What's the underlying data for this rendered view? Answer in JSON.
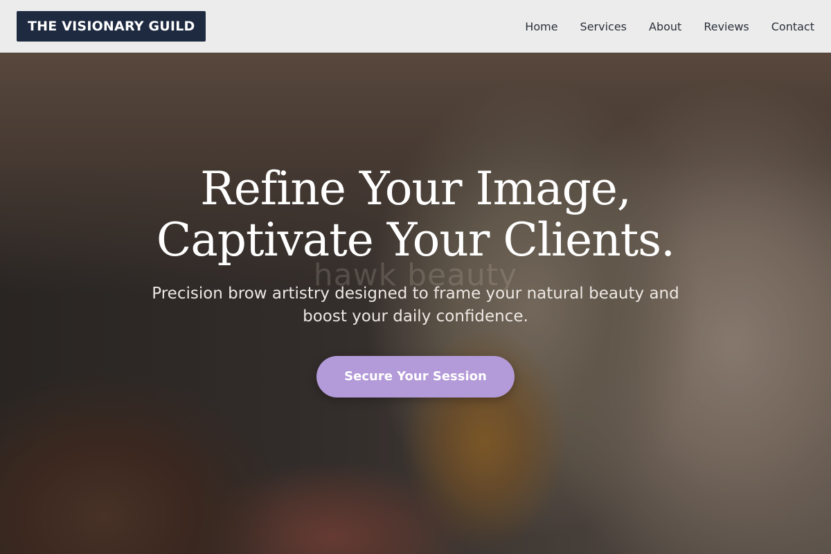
{
  "header": {
    "logo_text": "THE VISIONARY GUILD",
    "nav": [
      {
        "label": "Home"
      },
      {
        "label": "Services"
      },
      {
        "label": "About"
      },
      {
        "label": "Reviews"
      },
      {
        "label": "Contact"
      }
    ]
  },
  "hero": {
    "watermark": "hawk beauty",
    "title_line1": "Refine Your Image,",
    "title_line2": "Captivate Your Clients.",
    "subtitle": "Precision brow artistry designed to frame your natural beauty and boost your daily confidence.",
    "cta_label": "Secure Your Session"
  },
  "colors": {
    "header_bg": "#ececec",
    "logo_bg": "#1e2a40",
    "cta_bg": "#b39ad8",
    "hero_text": "#ffffff"
  }
}
